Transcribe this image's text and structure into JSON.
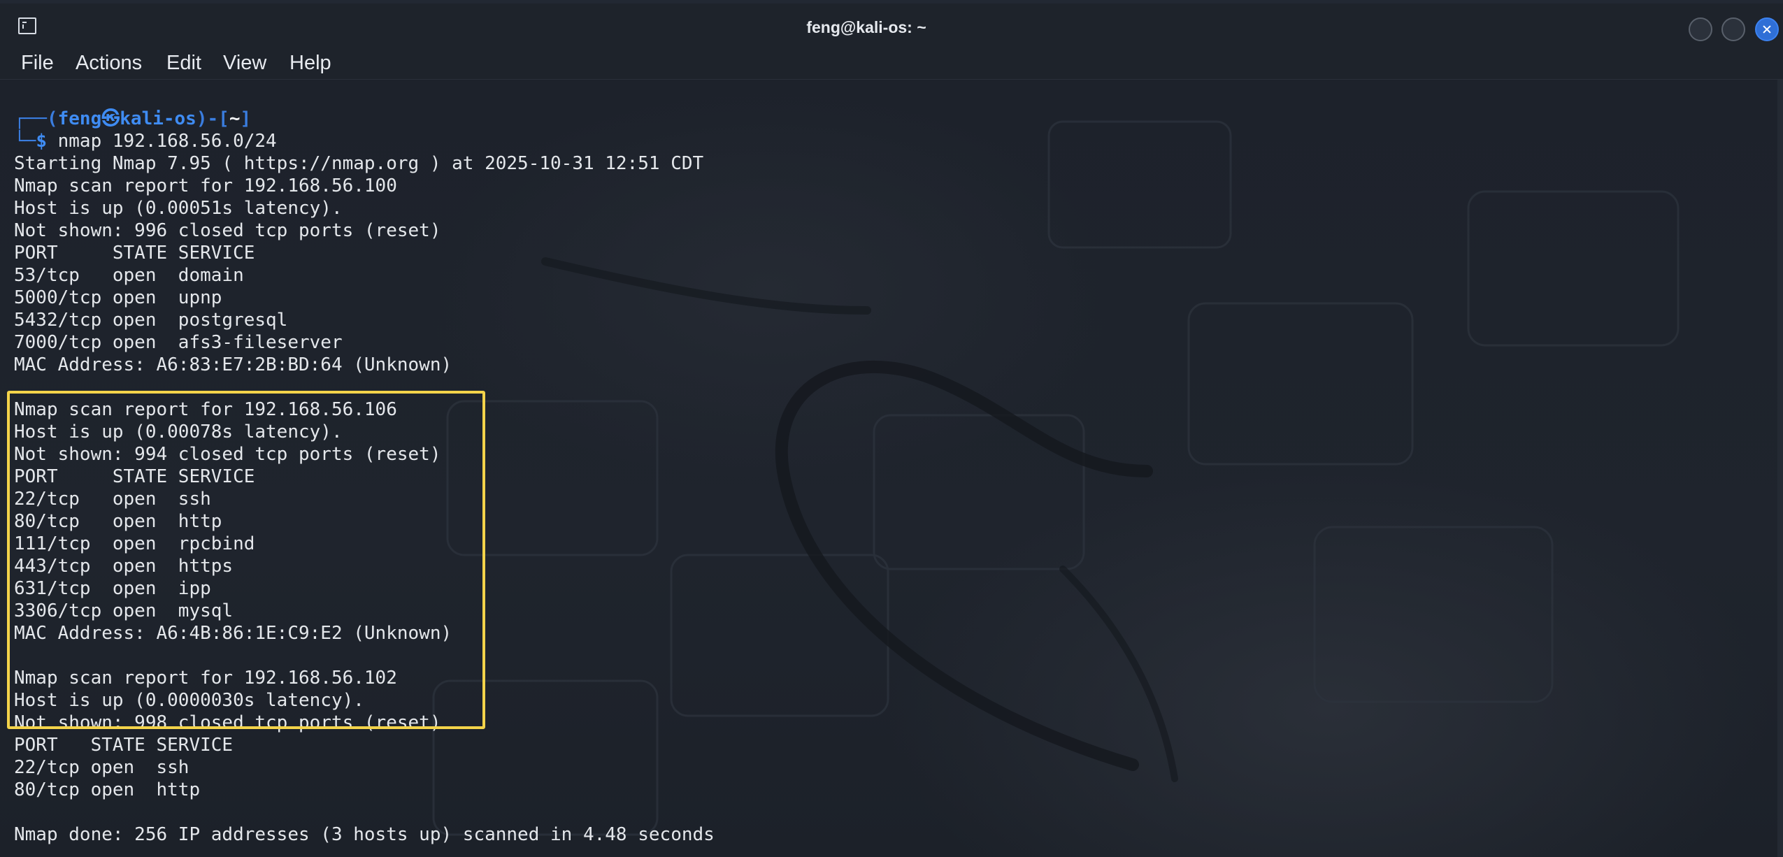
{
  "window": {
    "title": "feng@kali-os: ~"
  },
  "menu": [
    "File",
    "Actions",
    "Edit",
    "View",
    "Help"
  ],
  "prompt": {
    "box_top": "┌──(",
    "user": "feng",
    "at": "㉿",
    "host": "kali-os",
    "mid": ")-[",
    "dir": "~",
    "end": "]",
    "box_bottom": "└─",
    "dollar": "$",
    "command": " nmap 192.168.56.0/24"
  },
  "output": {
    "start": "Starting Nmap 7.95 ( https://nmap.org ) at 2025-10-31 12:51 CDT",
    "hosts": [
      {
        "report": "Nmap scan report for 192.168.56.100",
        "up": "Host is up (0.00051s latency).",
        "not_shown": "Not shown: 996 closed tcp ports (reset)",
        "header": "PORT     STATE SERVICE",
        "ports": [
          "53/tcp   open  domain",
          "5000/tcp open  upnp",
          "5432/tcp open  postgresql",
          "7000/tcp open  afs3-fileserver"
        ],
        "mac": "MAC Address: A6:83:E7:2B:BD:64 (Unknown)"
      },
      {
        "report": "Nmap scan report for 192.168.56.106",
        "up": "Host is up (0.00078s latency).",
        "not_shown": "Not shown: 994 closed tcp ports (reset)",
        "header": "PORT     STATE SERVICE",
        "ports": [
          "22/tcp   open  ssh",
          "80/tcp   open  http",
          "111/tcp  open  rpcbind",
          "443/tcp  open  https",
          "631/tcp  open  ipp",
          "3306/tcp open  mysql"
        ],
        "mac": "MAC Address: A6:4B:86:1E:C9:E2 (Unknown)"
      },
      {
        "report": "Nmap scan report for 192.168.56.102",
        "up": "Host is up (0.0000030s latency).",
        "not_shown": "Not shown: 998 closed tcp ports (reset)",
        "header": "PORT   STATE SERVICE",
        "ports": [
          "22/tcp open  ssh",
          "80/tcp open  http"
        ]
      }
    ],
    "done": "Nmap done: 256 IP addresses (3 hosts up) scanned in 4.48 seconds"
  },
  "colors": {
    "prompt_blue": "#3f8cf3",
    "highlight_border": "#f3d34a",
    "close_button": "#2f6fd6"
  }
}
